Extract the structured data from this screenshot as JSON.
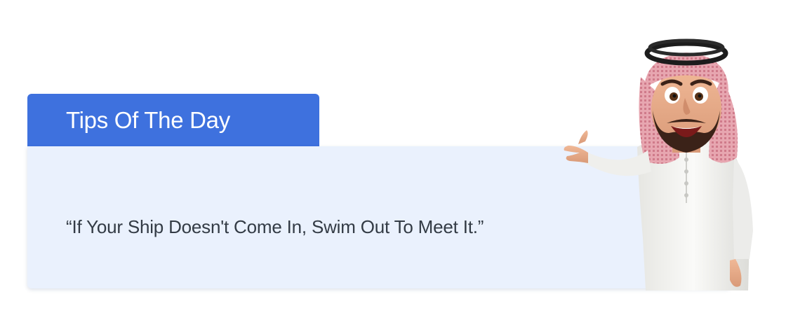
{
  "tip_card": {
    "title": "Tips Of The Day",
    "quote": "“If Your Ship Doesn't Come In, Swim Out To Meet It.”"
  },
  "mascot": {
    "icon": "arab-man-pointing-mascot"
  },
  "colors": {
    "accent": "#3e71de",
    "card_background": "#eaf1fd",
    "quote_text": "#333b45",
    "headwear_red": "#d98a98",
    "robe_white": "#f3f3f0"
  }
}
